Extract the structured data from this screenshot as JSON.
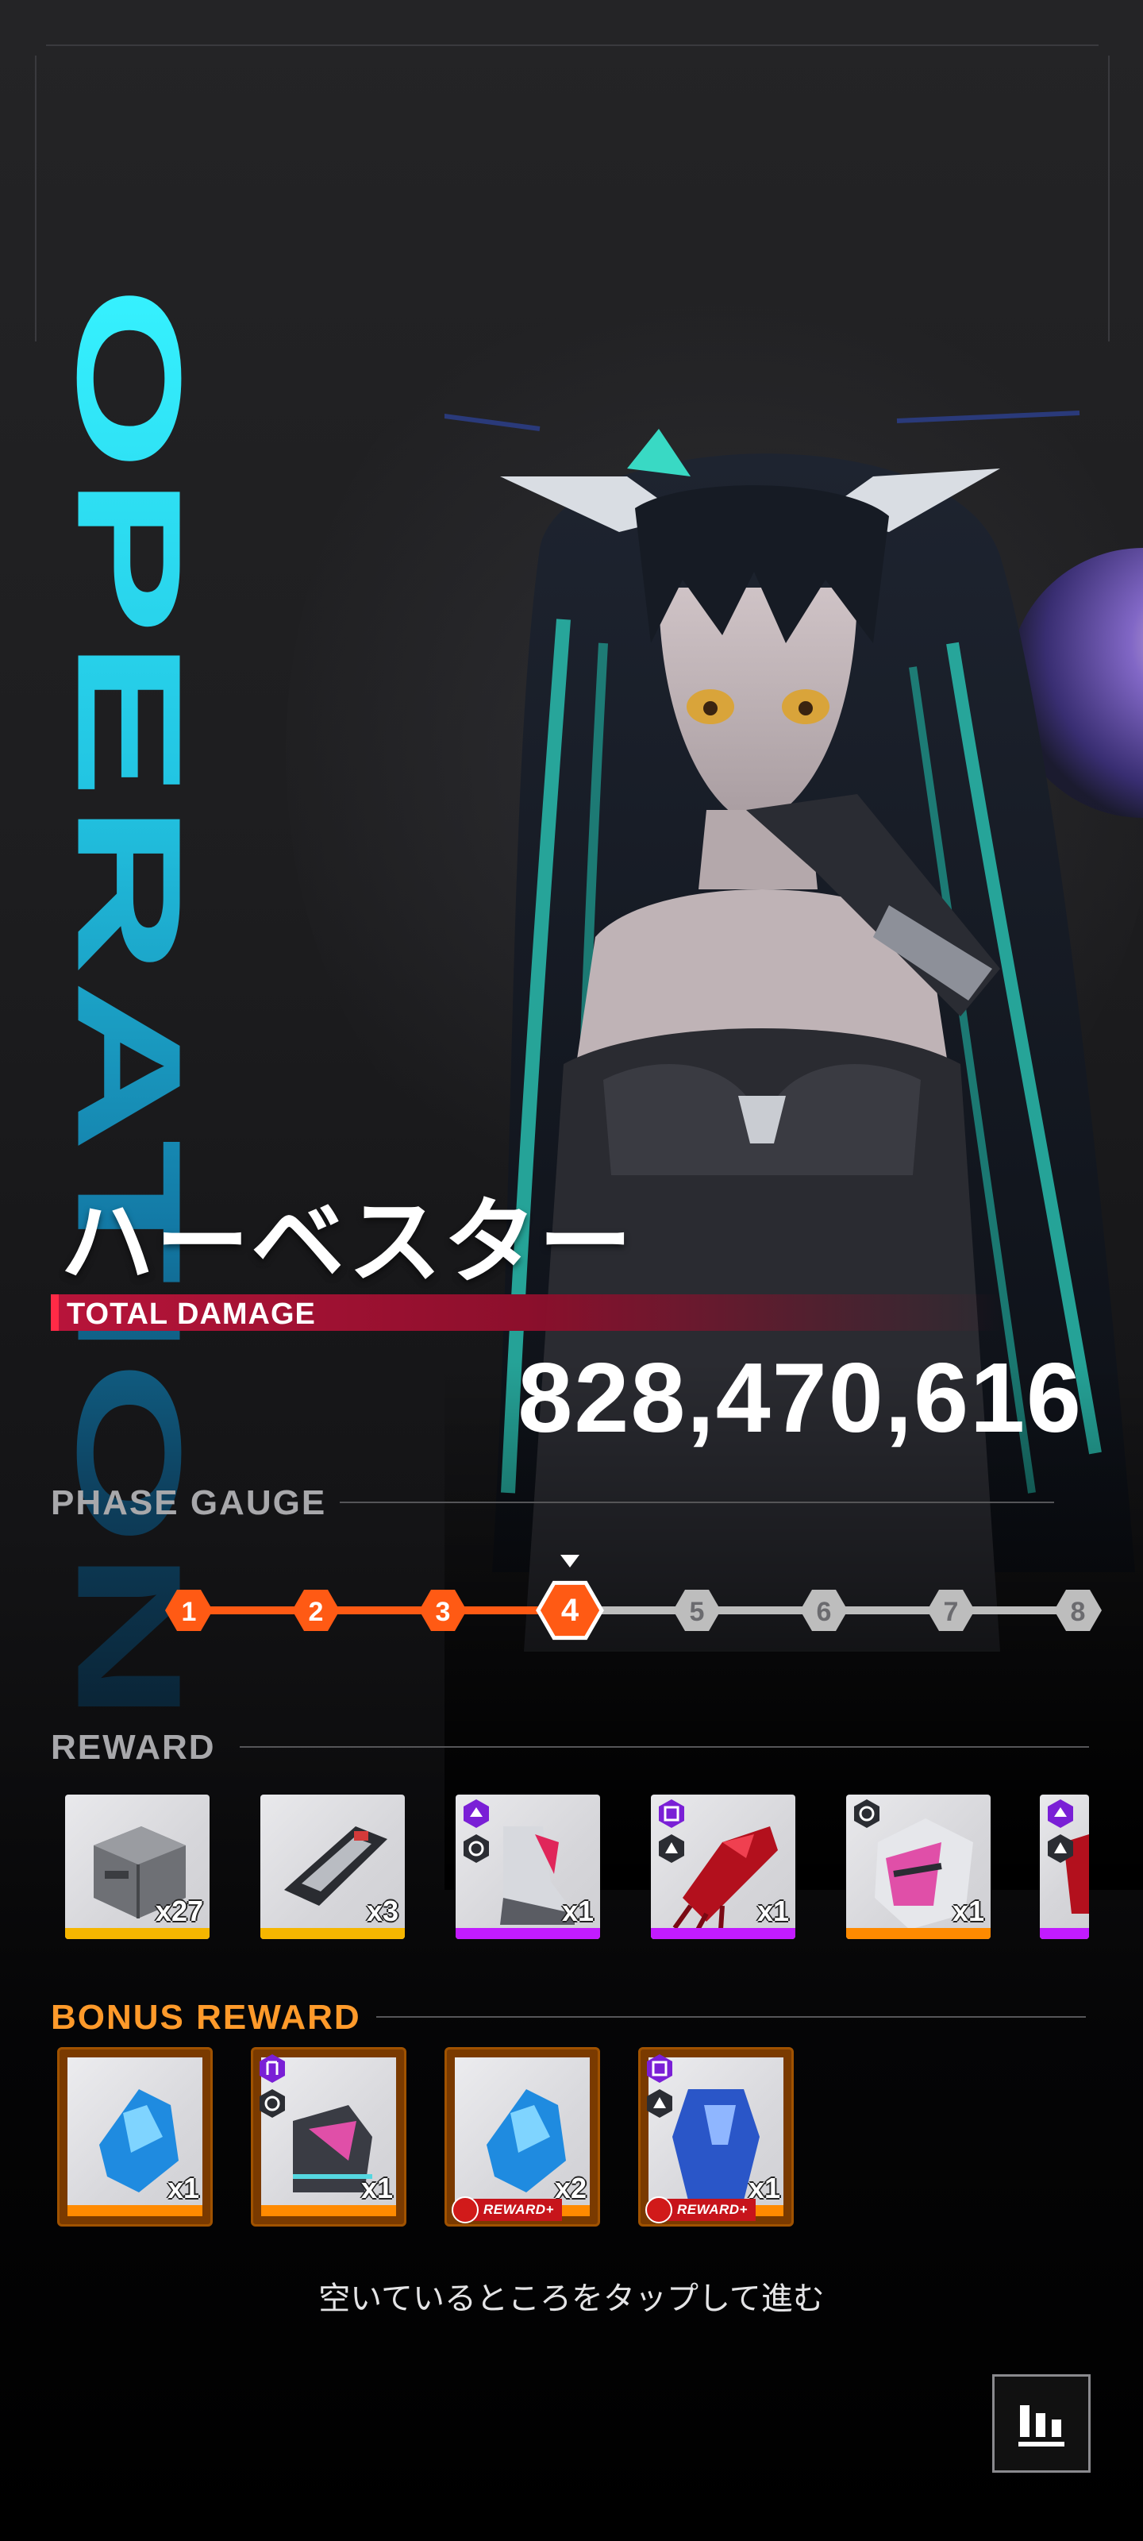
{
  "header": {
    "vertical_title": "OPERATION"
  },
  "boss": {
    "name": "ハーベスター"
  },
  "damage": {
    "label": "TOTAL DAMAGE",
    "value": "828,470,616"
  },
  "phase_gauge": {
    "title": "PHASE GAUGE",
    "current": 4,
    "phases": [
      "1",
      "2",
      "3",
      "4",
      "5",
      "6",
      "7",
      "8"
    ],
    "completed_color": "#ff5a14",
    "inactive_color": "#bdbdbd"
  },
  "reward": {
    "title": "REWARD",
    "items": [
      {
        "name": "supply-crate",
        "qty": "x27",
        "rarity_color": "#f6b600"
      },
      {
        "name": "ammo-module",
        "qty": "x3",
        "rarity_color": "#f6b600"
      },
      {
        "name": "white-armor-boots",
        "qty": "x1",
        "rarity_color": "#c21bff"
      },
      {
        "name": "red-armor-gauntlet",
        "qty": "x1",
        "rarity_color": "#c21bff"
      },
      {
        "name": "pink-armor-helm",
        "qty": "x1",
        "rarity_color": "#ff8a00"
      },
      {
        "name": "red-armor-partial",
        "qty": "",
        "rarity_color": "#c21bff"
      }
    ]
  },
  "bonus_reward": {
    "title": "BONUS REWARD",
    "tag_label": "REWARD+",
    "items": [
      {
        "name": "blue-core-crystal",
        "qty": "x1",
        "reward_plus": false
      },
      {
        "name": "pink-armor-boots",
        "qty": "x1",
        "reward_plus": false
      },
      {
        "name": "blue-core-crystal",
        "qty": "x2",
        "reward_plus": true
      },
      {
        "name": "blue-armor-suit",
        "qty": "x1",
        "reward_plus": true
      }
    ]
  },
  "footer": {
    "hint": "空いているところをタップして進む"
  },
  "colors": {
    "accent_cyan": "#36f2ff",
    "damage_red": "#b8143a",
    "bonus_orange": "#ff9a2a"
  }
}
